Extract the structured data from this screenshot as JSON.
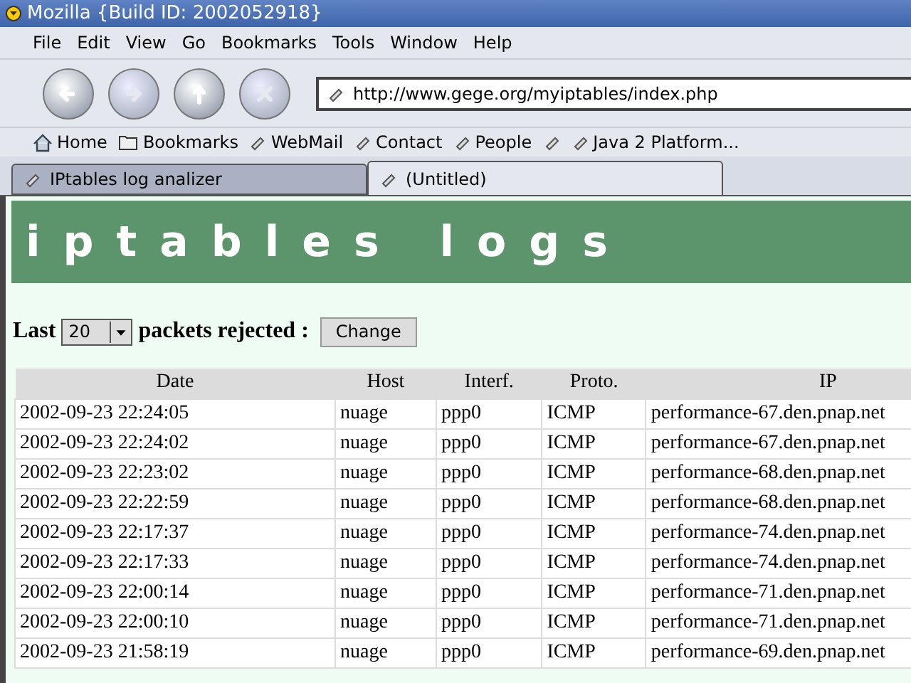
{
  "window": {
    "title": "Mozilla {Build ID: 2002052918}"
  },
  "menu": [
    "File",
    "Edit",
    "View",
    "Go",
    "Bookmarks",
    "Tools",
    "Window",
    "Help"
  ],
  "address": {
    "value": "http://www.gege.org/myiptables/index.php"
  },
  "bookmarks": [
    {
      "kind": "home",
      "label": "Home"
    },
    {
      "kind": "folder",
      "label": "Bookmarks"
    },
    {
      "kind": "link",
      "label": "WebMail"
    },
    {
      "kind": "link",
      "label": "Contact"
    },
    {
      "kind": "link",
      "label": "People"
    },
    {
      "kind": "link"
    },
    {
      "kind": "link",
      "label": "Java 2 Platform..."
    }
  ],
  "tabs": [
    {
      "label": "IPtables log analizer",
      "selected": false
    },
    {
      "label": "(Untitled)",
      "selected": true
    }
  ],
  "page": {
    "heading": "iptables logs",
    "last_label": "Last",
    "count_select": "20",
    "rejected_label": "packets rejected :",
    "change_button": "Change"
  },
  "table": {
    "columns": [
      "Date",
      "Host",
      "Interf.",
      "Proto.",
      "IP"
    ],
    "rows": [
      [
        "2002-09-23 22:24:05",
        "nuage",
        "ppp0",
        "ICMP",
        "performance-67.den.pnap.net"
      ],
      [
        "2002-09-23 22:24:02",
        "nuage",
        "ppp0",
        "ICMP",
        "performance-67.den.pnap.net"
      ],
      [
        "2002-09-23 22:23:02",
        "nuage",
        "ppp0",
        "ICMP",
        "performance-68.den.pnap.net"
      ],
      [
        "2002-09-23 22:22:59",
        "nuage",
        "ppp0",
        "ICMP",
        "performance-68.den.pnap.net"
      ],
      [
        "2002-09-23 22:17:37",
        "nuage",
        "ppp0",
        "ICMP",
        "performance-74.den.pnap.net"
      ],
      [
        "2002-09-23 22:17:33",
        "nuage",
        "ppp0",
        "ICMP",
        "performance-74.den.pnap.net"
      ],
      [
        "2002-09-23 22:00:14",
        "nuage",
        "ppp0",
        "ICMP",
        "performance-71.den.pnap.net"
      ],
      [
        "2002-09-23 22:00:10",
        "nuage",
        "ppp0",
        "ICMP",
        "performance-71.den.pnap.net"
      ],
      [
        "2002-09-23 21:58:19",
        "nuage",
        "ppp0",
        "ICMP",
        "performance-69.den.pnap.net"
      ]
    ]
  }
}
